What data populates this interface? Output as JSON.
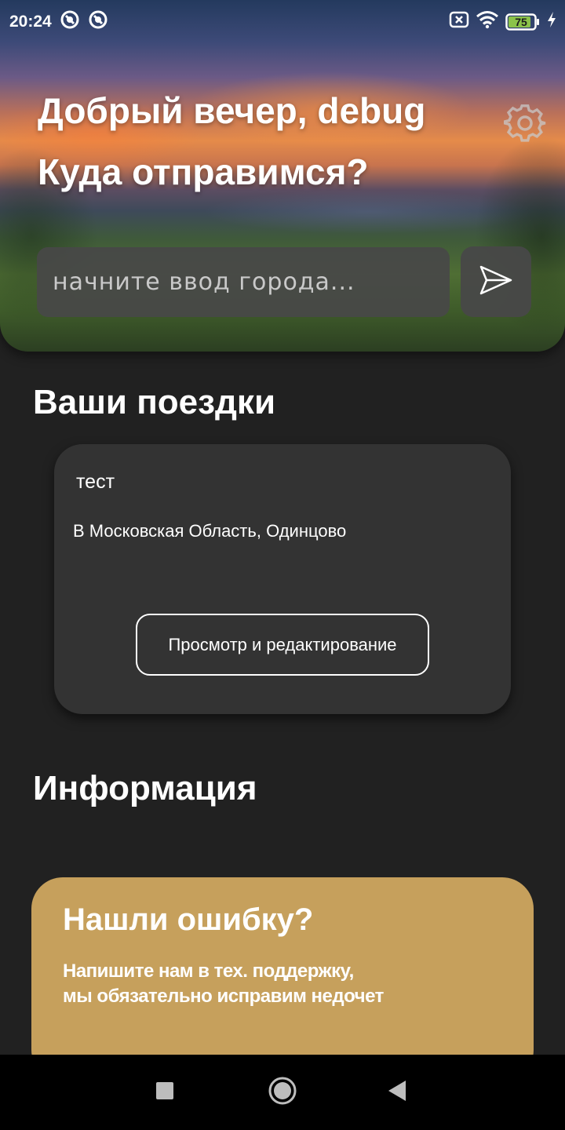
{
  "status_bar": {
    "time": "20:24",
    "battery_level": "75",
    "icons": [
      "app-notification-icon",
      "app-notification-icon",
      "sim-disabled-icon",
      "wifi-icon",
      "battery-icon",
      "charging-icon"
    ]
  },
  "header": {
    "greeting": "Добрый вечер, debug",
    "question": "Куда отправимся?",
    "settings_icon": "gear-icon"
  },
  "search": {
    "placeholder": "начните ввод города...",
    "value": "",
    "send_icon": "send-icon"
  },
  "trips": {
    "title": "Ваши поездки",
    "items": [
      {
        "name": "тест",
        "location": "В Московская Область, Одинцово",
        "button_label": "Просмотр и редактирование"
      }
    ]
  },
  "info": {
    "title": "Информация",
    "bug_card": {
      "title": "Нашли ошибку?",
      "line1": "Напишите нам в тех. поддержку,",
      "line2": "мы обязательно исправим недочет"
    }
  },
  "nav": {
    "icons": [
      "recent-apps-icon",
      "home-icon",
      "back-icon"
    ]
  },
  "colors": {
    "background": "#212121",
    "card": "#333333",
    "accent_card": "#c6a05c",
    "input": "#484848"
  }
}
